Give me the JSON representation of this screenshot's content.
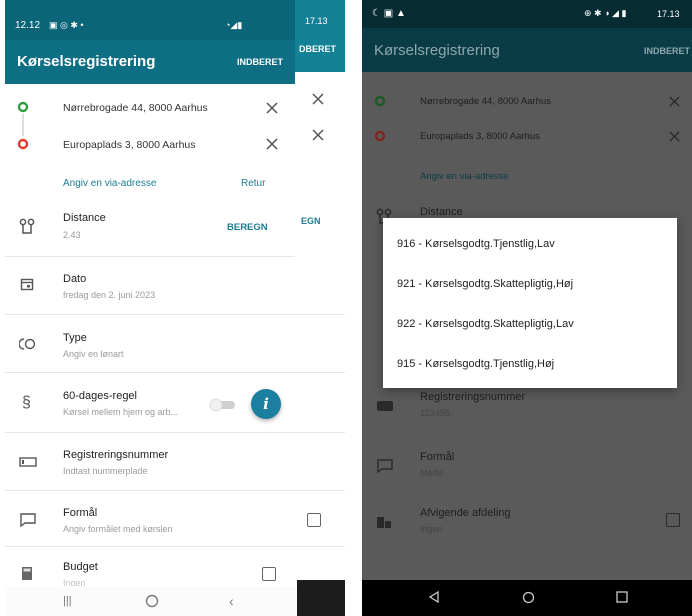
{
  "left": {
    "status_time": "12.12",
    "bg_status_time": "17.13",
    "title": "Kørselsregistrering",
    "report_button": "INDBERET",
    "bg_report_button": "DBERET",
    "addresses": [
      {
        "text": "Nørrebrogade 44, 8000 Aarhus",
        "dot_color": "#2e9e3e"
      },
      {
        "text": "Europaplads 3, 8000 Aarhus",
        "dot_color": "#e03b2f"
      }
    ],
    "via_link": "Angiv en via-adresse",
    "return_link": "Retur",
    "distance": {
      "label": "Distance",
      "value": "2.43",
      "button": "BEREGN",
      "bg_button": "EGN"
    },
    "rows": [
      {
        "label": "Dato",
        "sub": "fredag den 2. juni 2023",
        "icon": "calendar-icon"
      },
      {
        "label": "Type",
        "sub": "Angiv en lønart",
        "icon": "type-icon"
      },
      {
        "label": "60-dages-regel",
        "sub": "Kørsel mellem hjem og arb...",
        "icon": "paragraph-icon"
      },
      {
        "label": "Registreringsnummer",
        "sub": "Indtast nummerplade",
        "icon": "license-plate-icon"
      },
      {
        "label": "Formål",
        "sub": "Angiv formålet med kørslen",
        "icon": "comment-icon"
      },
      {
        "label": "Budget",
        "sub": "Ingen",
        "icon": "calculator-icon"
      }
    ],
    "info_glyph": "i"
  },
  "right": {
    "status_time": "17.13",
    "title": "Kørselsregistrering",
    "report_button": "INDBERET",
    "addresses": [
      {
        "text": "Nørrebrogade 44, 8000 Aarhus"
      },
      {
        "text": "Europaplads 3, 8000 Aarhus"
      }
    ],
    "via_link": "Angiv en via-adresse",
    "distance_label": "Distance",
    "rows": [
      {
        "label": "Registreringsnummer",
        "sub": "123456"
      },
      {
        "label": "Formål",
        "sub": "Møde"
      },
      {
        "label": "Afvigende afdeling",
        "sub": "Ingen"
      }
    ],
    "dialog_options": [
      "916 - Kørselsgodtg.Tjenstlig,Lav",
      "921 - Kørselsgodtg.Skattepligtig,Høj",
      "922 - Kørselsgodtg.Skattepligtig,Lav",
      "915 - Kørselsgodtg.Tjenstlig,Høj"
    ]
  },
  "colors": {
    "teal": "#0d6e84",
    "teal_dark": "#0a5b6d",
    "link": "#1a7d93",
    "info_button": "#1b7fa0"
  }
}
